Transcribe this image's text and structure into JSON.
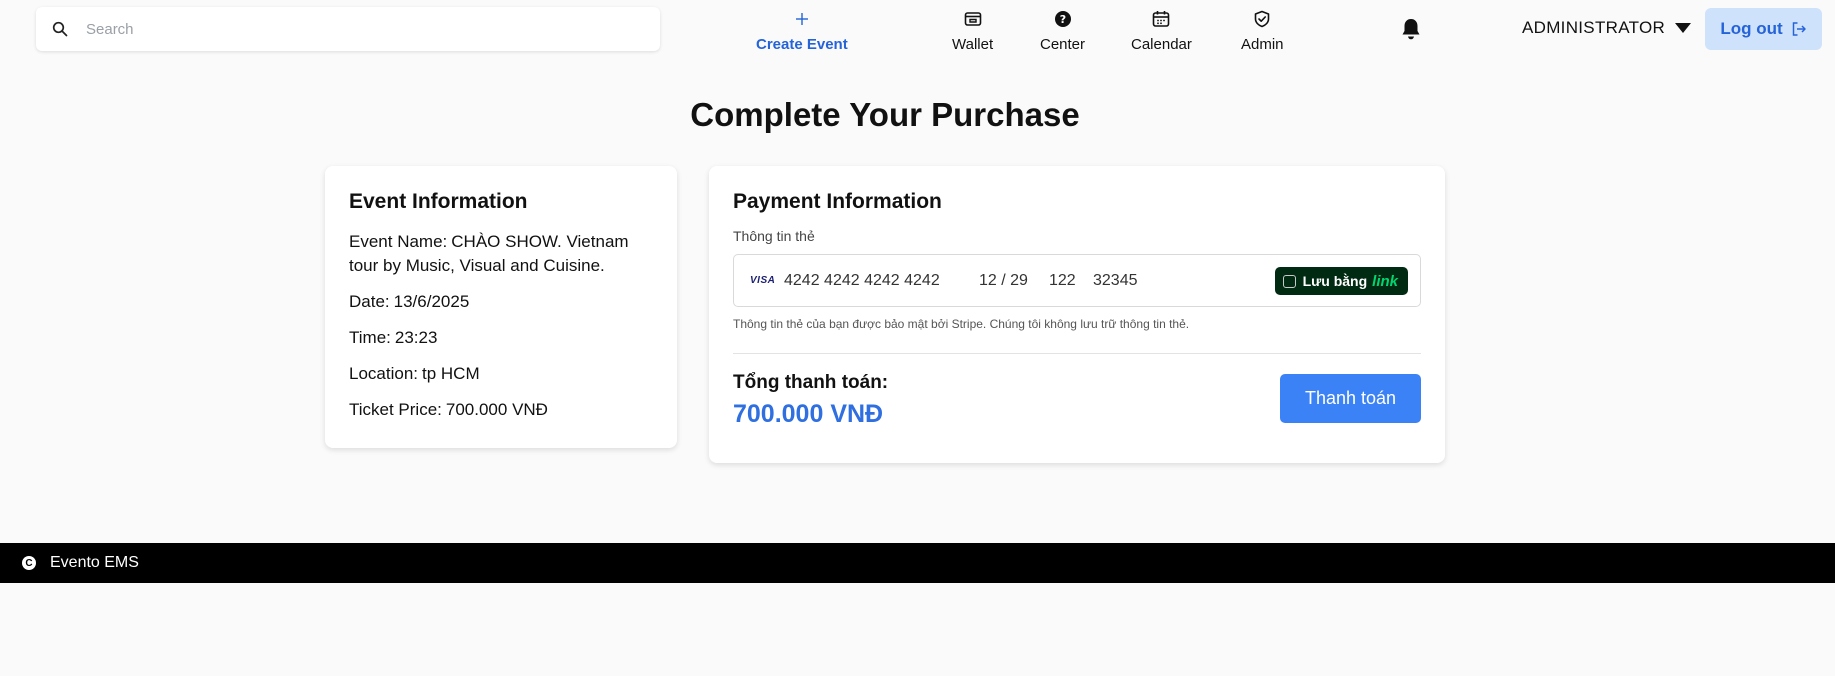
{
  "header": {
    "search_placeholder": "Search",
    "nav": {
      "create_event": "Create Event",
      "wallet": "Wallet",
      "center": "Center",
      "calendar": "Calendar",
      "admin": "Admin"
    },
    "user_menu": "ADMINISTRATOR",
    "logout": "Log out"
  },
  "page": {
    "title": "Complete Your Purchase"
  },
  "event_info": {
    "heading": "Event Information",
    "name_label": "Event Name:",
    "name_value": "CHÀO SHOW. Vietnam tour by Music, Visual and Cuisine.",
    "date_label": "Date:",
    "date_value": "13/6/2025",
    "time_label": "Time:",
    "time_value": "23:23",
    "location_label": "Location:",
    "location_value": "tp HCM",
    "price_label": "Ticket Price:",
    "price_value": "700.000 VNĐ"
  },
  "payment_info": {
    "heading": "Payment Information",
    "card_label": "Thông tin thẻ",
    "card_brand": "VISA",
    "card_number": "4242 4242 4242 4242",
    "card_expiry": "12 / 29",
    "card_cvc": "122",
    "card_zip": "32345",
    "link_save_label": "Lưu bằng",
    "link_brand": "link",
    "secure_note": "Thông tin thẻ của bạn được bảo mật bởi Stripe. Chúng tôi không lưu trữ thông tin thẻ.",
    "total_label": "Tổng thanh toán:",
    "total_value": "700.000 VNĐ",
    "pay_button": "Thanh toán"
  },
  "footer": {
    "brand": "Evento EMS"
  },
  "colors": {
    "accent": "#2563d8",
    "pay_button": "#3b82f6",
    "total": "#2f6fe0",
    "logout_bg": "#cfe2fb",
    "link_bg": "#012a13",
    "link_green": "#00d66f",
    "footer_bg": "#000000"
  }
}
